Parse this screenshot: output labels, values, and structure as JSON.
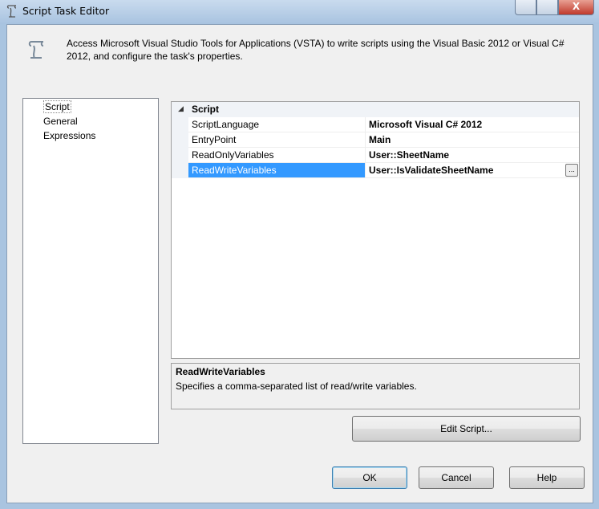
{
  "window": {
    "title": "Script Task Editor",
    "close_label": "X"
  },
  "description": "Access Microsoft Visual Studio Tools for Applications (VSTA) to write scripts using the Visual Basic 2012 or Visual C# 2012, and configure the task's properties.",
  "nav": {
    "items": [
      {
        "label": "Script"
      },
      {
        "label": "General"
      },
      {
        "label": "Expressions"
      }
    ]
  },
  "grid": {
    "category": "Script",
    "rows": [
      {
        "name": "ScriptLanguage",
        "value": "Microsoft Visual C# 2012"
      },
      {
        "name": "EntryPoint",
        "value": "Main"
      },
      {
        "name": "ReadOnlyVariables",
        "value": "User::SheetName"
      },
      {
        "name": "ReadWriteVariables",
        "value": "User::IsValidateSheetName"
      }
    ],
    "ellipsis": "..."
  },
  "help": {
    "title": "ReadWriteVariables",
    "text": "Specifies a comma-separated list of read/write variables."
  },
  "buttons": {
    "edit_script": "Edit Script...",
    "ok": "OK",
    "cancel": "Cancel",
    "help": "Help"
  },
  "colors": {
    "selection": "#3399ff"
  }
}
